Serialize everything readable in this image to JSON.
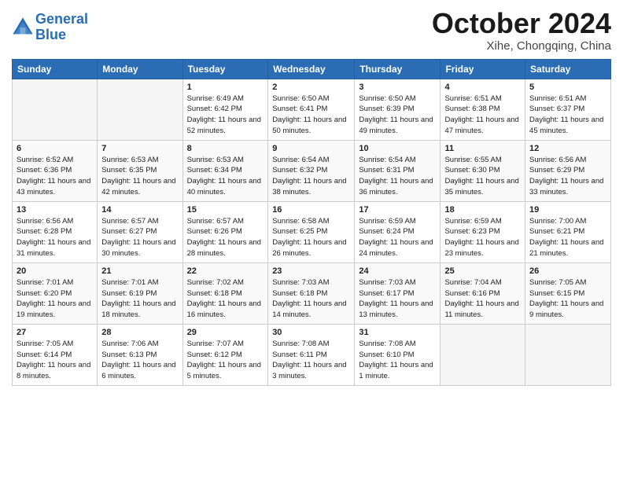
{
  "header": {
    "logo_line1": "General",
    "logo_line2": "Blue",
    "main_title": "October 2024",
    "subtitle": "Xihe, Chongqing, China"
  },
  "days_of_week": [
    "Sunday",
    "Monday",
    "Tuesday",
    "Wednesday",
    "Thursday",
    "Friday",
    "Saturday"
  ],
  "weeks": [
    [
      {
        "day": "",
        "info": ""
      },
      {
        "day": "",
        "info": ""
      },
      {
        "day": "1",
        "info": "Sunrise: 6:49 AM\nSunset: 6:42 PM\nDaylight: 11 hours and 52 minutes."
      },
      {
        "day": "2",
        "info": "Sunrise: 6:50 AM\nSunset: 6:41 PM\nDaylight: 11 hours and 50 minutes."
      },
      {
        "day": "3",
        "info": "Sunrise: 6:50 AM\nSunset: 6:39 PM\nDaylight: 11 hours and 49 minutes."
      },
      {
        "day": "4",
        "info": "Sunrise: 6:51 AM\nSunset: 6:38 PM\nDaylight: 11 hours and 47 minutes."
      },
      {
        "day": "5",
        "info": "Sunrise: 6:51 AM\nSunset: 6:37 PM\nDaylight: 11 hours and 45 minutes."
      }
    ],
    [
      {
        "day": "6",
        "info": "Sunrise: 6:52 AM\nSunset: 6:36 PM\nDaylight: 11 hours and 43 minutes."
      },
      {
        "day": "7",
        "info": "Sunrise: 6:53 AM\nSunset: 6:35 PM\nDaylight: 11 hours and 42 minutes."
      },
      {
        "day": "8",
        "info": "Sunrise: 6:53 AM\nSunset: 6:34 PM\nDaylight: 11 hours and 40 minutes."
      },
      {
        "day": "9",
        "info": "Sunrise: 6:54 AM\nSunset: 6:32 PM\nDaylight: 11 hours and 38 minutes."
      },
      {
        "day": "10",
        "info": "Sunrise: 6:54 AM\nSunset: 6:31 PM\nDaylight: 11 hours and 36 minutes."
      },
      {
        "day": "11",
        "info": "Sunrise: 6:55 AM\nSunset: 6:30 PM\nDaylight: 11 hours and 35 minutes."
      },
      {
        "day": "12",
        "info": "Sunrise: 6:56 AM\nSunset: 6:29 PM\nDaylight: 11 hours and 33 minutes."
      }
    ],
    [
      {
        "day": "13",
        "info": "Sunrise: 6:56 AM\nSunset: 6:28 PM\nDaylight: 11 hours and 31 minutes."
      },
      {
        "day": "14",
        "info": "Sunrise: 6:57 AM\nSunset: 6:27 PM\nDaylight: 11 hours and 30 minutes."
      },
      {
        "day": "15",
        "info": "Sunrise: 6:57 AM\nSunset: 6:26 PM\nDaylight: 11 hours and 28 minutes."
      },
      {
        "day": "16",
        "info": "Sunrise: 6:58 AM\nSunset: 6:25 PM\nDaylight: 11 hours and 26 minutes."
      },
      {
        "day": "17",
        "info": "Sunrise: 6:59 AM\nSunset: 6:24 PM\nDaylight: 11 hours and 24 minutes."
      },
      {
        "day": "18",
        "info": "Sunrise: 6:59 AM\nSunset: 6:23 PM\nDaylight: 11 hours and 23 minutes."
      },
      {
        "day": "19",
        "info": "Sunrise: 7:00 AM\nSunset: 6:21 PM\nDaylight: 11 hours and 21 minutes."
      }
    ],
    [
      {
        "day": "20",
        "info": "Sunrise: 7:01 AM\nSunset: 6:20 PM\nDaylight: 11 hours and 19 minutes."
      },
      {
        "day": "21",
        "info": "Sunrise: 7:01 AM\nSunset: 6:19 PM\nDaylight: 11 hours and 18 minutes."
      },
      {
        "day": "22",
        "info": "Sunrise: 7:02 AM\nSunset: 6:18 PM\nDaylight: 11 hours and 16 minutes."
      },
      {
        "day": "23",
        "info": "Sunrise: 7:03 AM\nSunset: 6:18 PM\nDaylight: 11 hours and 14 minutes."
      },
      {
        "day": "24",
        "info": "Sunrise: 7:03 AM\nSunset: 6:17 PM\nDaylight: 11 hours and 13 minutes."
      },
      {
        "day": "25",
        "info": "Sunrise: 7:04 AM\nSunset: 6:16 PM\nDaylight: 11 hours and 11 minutes."
      },
      {
        "day": "26",
        "info": "Sunrise: 7:05 AM\nSunset: 6:15 PM\nDaylight: 11 hours and 9 minutes."
      }
    ],
    [
      {
        "day": "27",
        "info": "Sunrise: 7:05 AM\nSunset: 6:14 PM\nDaylight: 11 hours and 8 minutes."
      },
      {
        "day": "28",
        "info": "Sunrise: 7:06 AM\nSunset: 6:13 PM\nDaylight: 11 hours and 6 minutes."
      },
      {
        "day": "29",
        "info": "Sunrise: 7:07 AM\nSunset: 6:12 PM\nDaylight: 11 hours and 5 minutes."
      },
      {
        "day": "30",
        "info": "Sunrise: 7:08 AM\nSunset: 6:11 PM\nDaylight: 11 hours and 3 minutes."
      },
      {
        "day": "31",
        "info": "Sunrise: 7:08 AM\nSunset: 6:10 PM\nDaylight: 11 hours and 1 minute."
      },
      {
        "day": "",
        "info": ""
      },
      {
        "day": "",
        "info": ""
      }
    ]
  ]
}
